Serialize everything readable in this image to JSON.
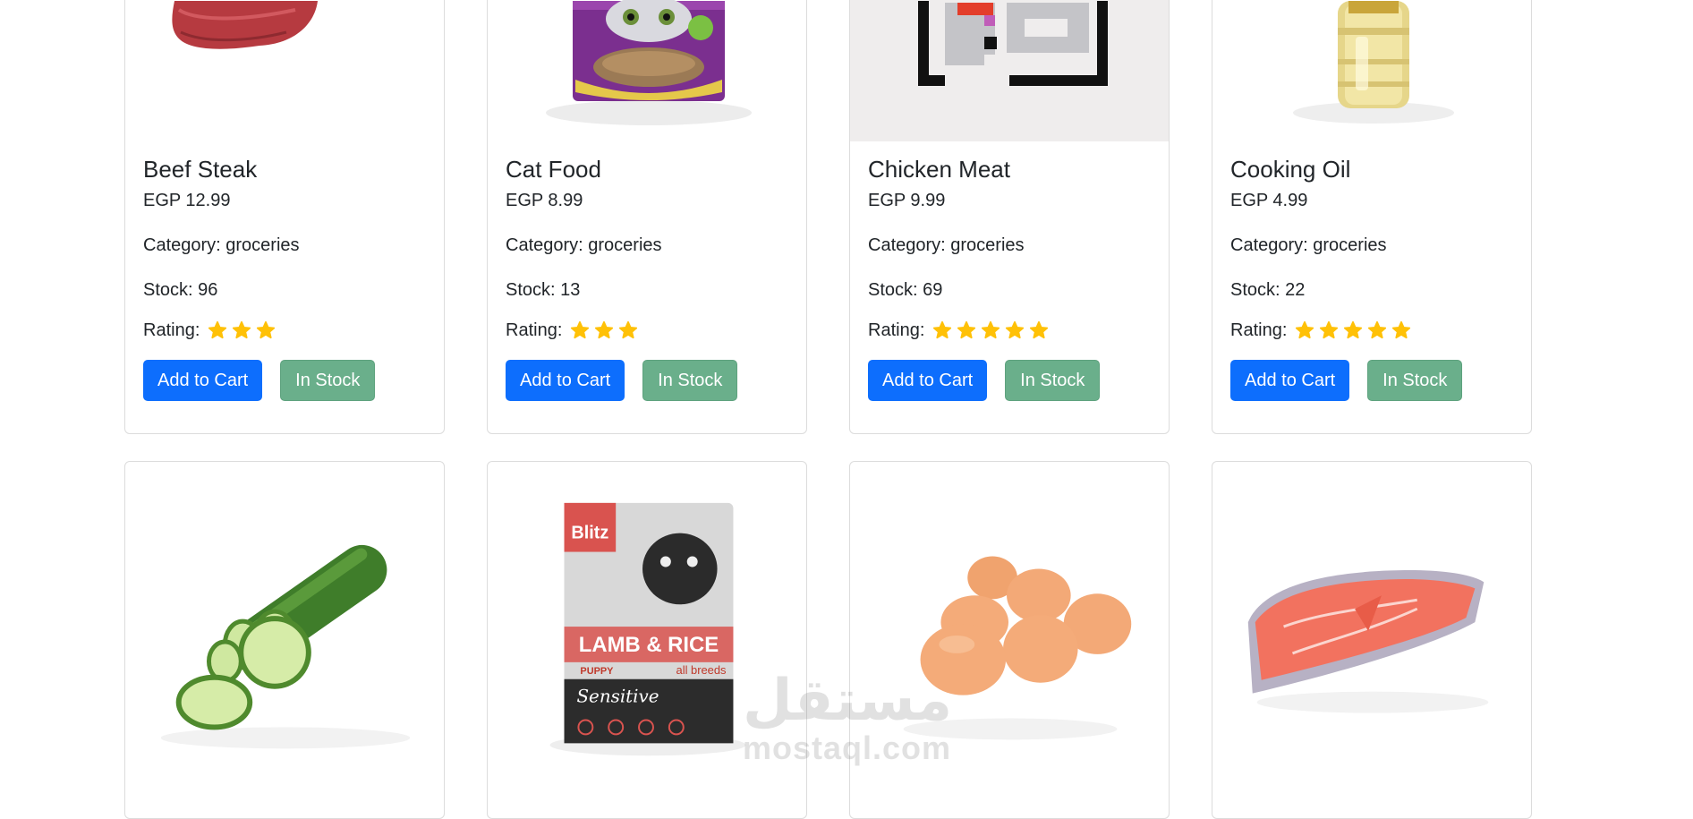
{
  "products": [
    {
      "title": "Beef Steak",
      "price": "EGP 12.99",
      "category": "Category: groceries",
      "stock": "Stock: 96",
      "rating_label": "Rating:",
      "rating_stars": 3,
      "add_label": "Add to Cart",
      "stock_label": "In Stock"
    },
    {
      "title": "Cat Food",
      "price": "EGP 8.99",
      "category": "Category: groceries",
      "stock": "Stock: 13",
      "rating_label": "Rating:",
      "rating_stars": 3,
      "add_label": "Add to Cart",
      "stock_label": "In Stock"
    },
    {
      "title": "Chicken Meat",
      "price": "EGP 9.99",
      "category": "Category: groceries",
      "stock": "Stock: 69",
      "rating_label": "Rating:",
      "rating_stars": 5,
      "add_label": "Add to Cart",
      "stock_label": "In Stock"
    },
    {
      "title": "Cooking Oil",
      "price": "EGP 4.99",
      "category": "Category: groceries",
      "stock": "Stock: 22",
      "rating_label": "Rating:",
      "rating_stars": 5,
      "add_label": "Add to Cart",
      "stock_label": "In Stock"
    }
  ],
  "product_images_row2": [
    "cucumber-image",
    "dog-food-image",
    "eggs-image",
    "fish-steak-image"
  ],
  "dog_food_bag": {
    "brand": "Blitz",
    "product": "LAMB & RICE",
    "sub": "PUPPY",
    "breeds": "all breeds",
    "line": "Sensitive"
  },
  "watermark": {
    "arabic": "مستقل",
    "latin": "mostaql.com"
  },
  "colors": {
    "primary": "#0d6efd",
    "success": "#6aaf8b",
    "star": "#ffc107",
    "border": "#dcdcdc"
  }
}
